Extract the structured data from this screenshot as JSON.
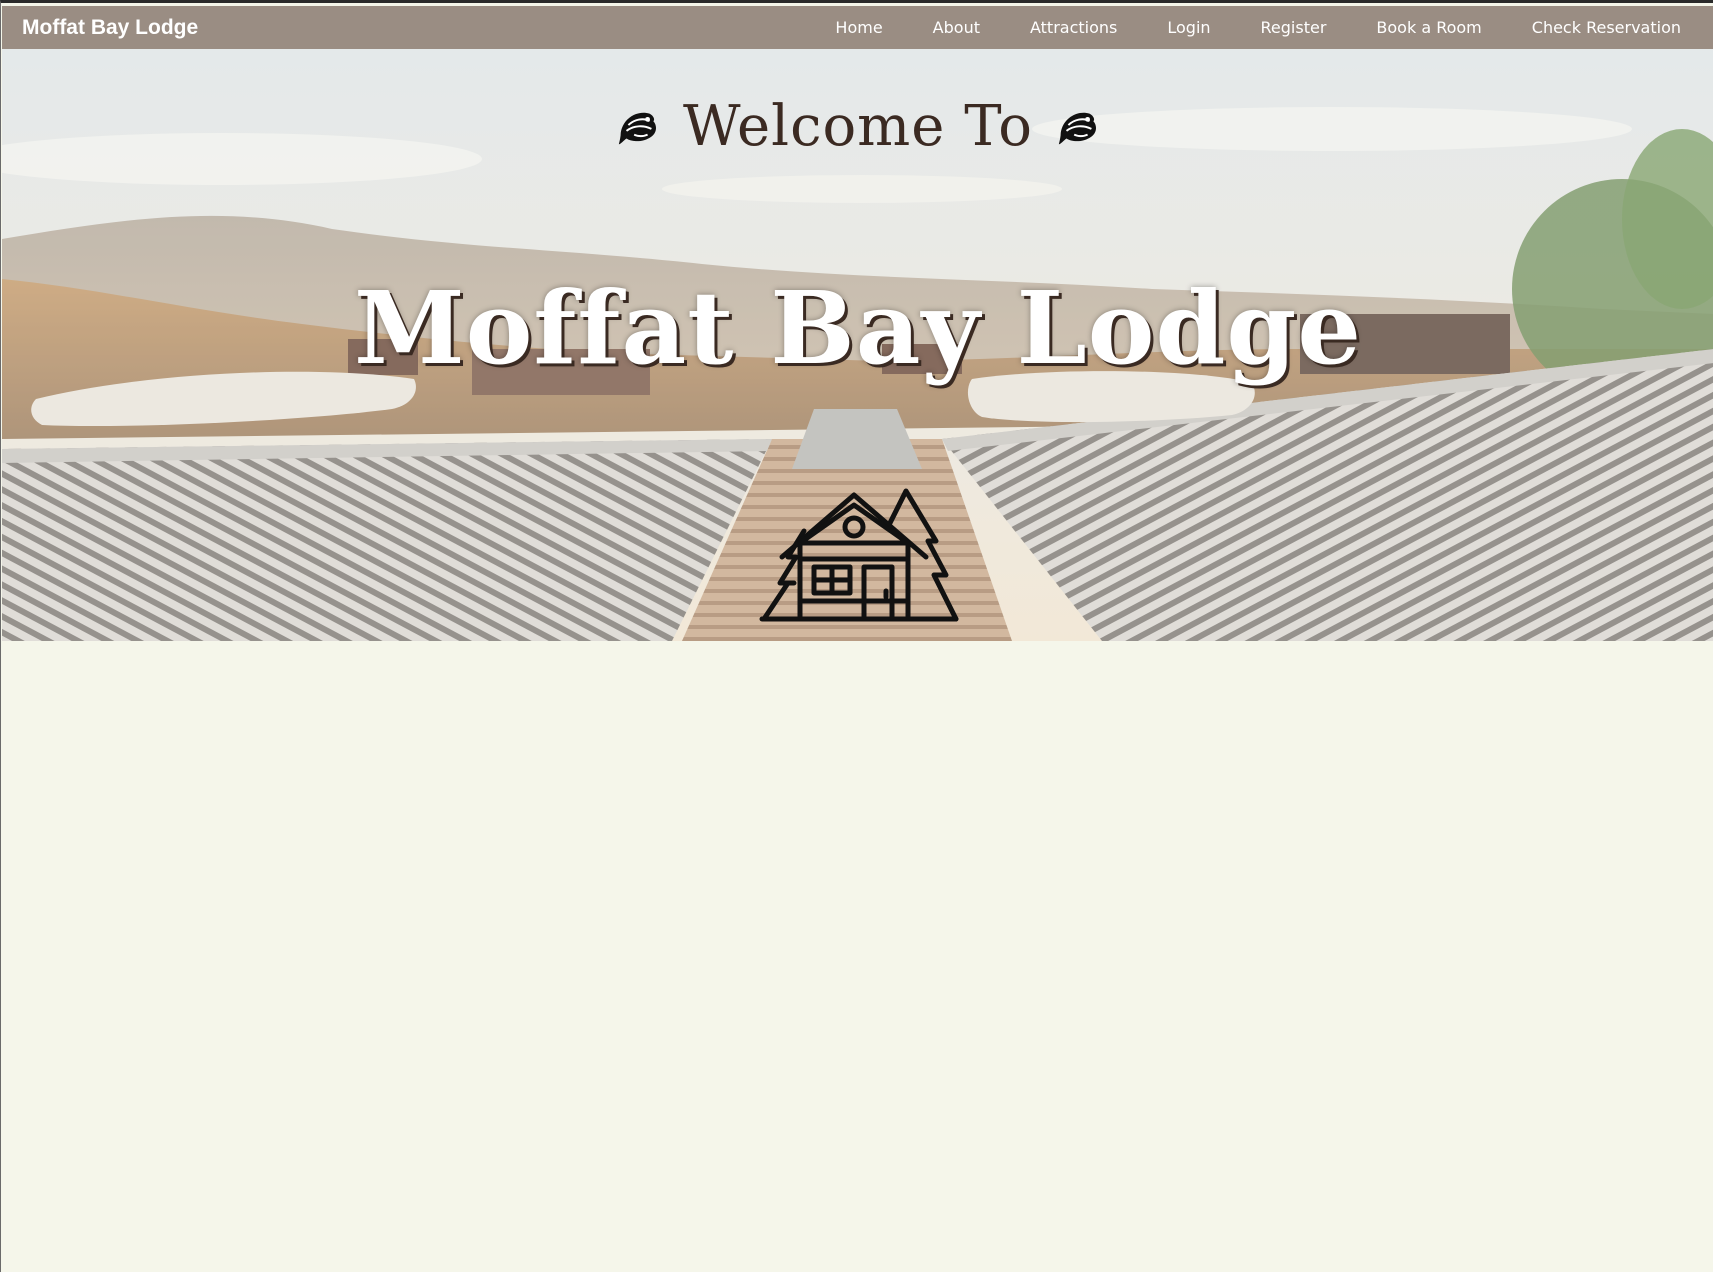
{
  "navbar": {
    "brand": "Moffat Bay Lodge",
    "links": [
      {
        "label": "Home"
      },
      {
        "label": "About"
      },
      {
        "label": "Attractions"
      },
      {
        "label": "Login"
      },
      {
        "label": "Register"
      },
      {
        "label": "Book a Room"
      },
      {
        "label": "Check Reservation"
      }
    ],
    "colors": {
      "background": "#9a8d83",
      "text": "#ffffff"
    }
  },
  "hero": {
    "welcome": "Welcome To",
    "title": "Moffat Bay Lodge",
    "icons": [
      "fish-icon",
      "fish-icon",
      "cabin-icon"
    ],
    "colors": {
      "welcome_text": "#3b2a22",
      "title_text": "#ffffff",
      "page_background": "#f5f6ea"
    }
  }
}
